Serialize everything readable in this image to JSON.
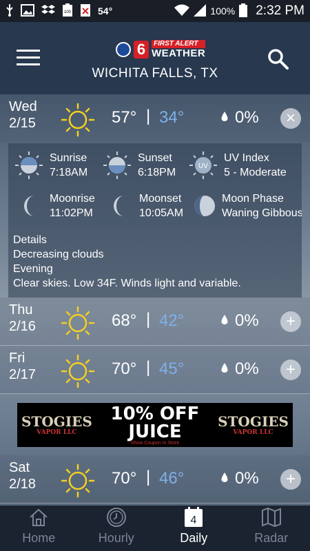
{
  "status_bar": {
    "temperature": "54°",
    "battery": "100%",
    "time": "2:32 PM",
    "icons": [
      "usb-icon",
      "image-icon",
      "dropbox-icon",
      "battery-full-icon",
      "close-box-icon",
      "wifi-icon",
      "signal-icon",
      "battery-icon"
    ]
  },
  "header": {
    "logo_first_alert": "FIRST ALERT",
    "logo_weather": "WEATHER",
    "logo_channel": "6",
    "location": "WICHITA FALLS, TX"
  },
  "days": [
    {
      "day": "Wed",
      "date": "2/15",
      "high": "57°",
      "low": "34°",
      "precip": "0%",
      "toggle": "×",
      "expanded": true
    },
    {
      "day": "Thu",
      "date": "2/16",
      "high": "68°",
      "low": "42°",
      "precip": "0%",
      "toggle": "+",
      "expanded": false
    },
    {
      "day": "Fri",
      "date": "2/17",
      "high": "70°",
      "low": "45°",
      "precip": "0%",
      "toggle": "+",
      "expanded": false
    },
    {
      "day": "Sat",
      "date": "2/18",
      "high": "70°",
      "low": "46°",
      "precip": "0%",
      "toggle": "+",
      "expanded": false
    }
  ],
  "separator": "|",
  "detail": {
    "sunrise_label": "Sunrise",
    "sunrise_time": "7:18AM",
    "sunset_label": "Sunset",
    "sunset_time": "6:18PM",
    "uv_label": "UV Index",
    "uv_value": "5 - Moderate",
    "uv_badge": "UV",
    "moonrise_label": "Moonrise",
    "moonrise_time": "11:02PM",
    "moonset_label": "Moonset",
    "moonset_time": "10:05AM",
    "moonphase_label": "Moon Phase",
    "moonphase_value": "Waning Gibbous",
    "details_heading": "Details",
    "details_summary": "Decreasing clouds",
    "details_period": "Evening",
    "details_text": "Clear skies. Low 34F. Winds light and variable."
  },
  "ad": {
    "brand": "STOGIES",
    "brand_sub": "VAPOR LLC",
    "line1": "10% OFF",
    "line2": "JUICE",
    "fine_print": "Show Coupon In Store"
  },
  "nav": {
    "home": "Home",
    "hourly": "Hourly",
    "daily": "Daily",
    "daily_badge": "4",
    "radar": "Radar"
  },
  "colors": {
    "low_temp": "#7fb0e8",
    "sun": "#f5d020",
    "header_bg": "#27384f",
    "nav_bg": "#1c2330"
  }
}
